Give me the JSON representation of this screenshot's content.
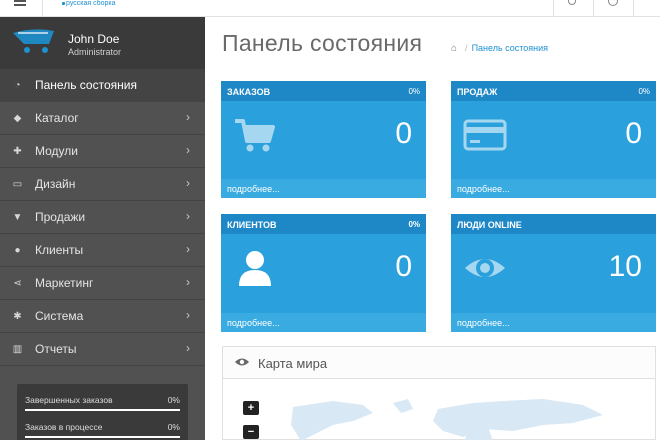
{
  "topbar": {
    "brand_sub": "русская сборка"
  },
  "sidebar": {
    "user_name": "John Doe",
    "user_role": "Administrator",
    "items": [
      {
        "label": "Панель состояния",
        "icon": "dashboard-icon",
        "active": true
      },
      {
        "label": "Каталог",
        "icon": "tag-icon"
      },
      {
        "label": "Модули",
        "icon": "puzzle-icon"
      },
      {
        "label": "Дизайн",
        "icon": "monitor-icon"
      },
      {
        "label": "Продажи",
        "icon": "shopping-cart-icon"
      },
      {
        "label": "Клиенты",
        "icon": "user-icon"
      },
      {
        "label": "Маркетинг",
        "icon": "share-icon"
      },
      {
        "label": "Система",
        "icon": "gear-icon"
      },
      {
        "label": "Отчеты",
        "icon": "bar-chart-icon"
      }
    ],
    "progress": [
      {
        "label": "Завершенных заказов",
        "pct": "0%"
      },
      {
        "label": "Заказов в процессе",
        "pct": "0%"
      }
    ]
  },
  "main": {
    "title": "Панель состояния",
    "breadcrumb": "Панель состояния",
    "tiles": [
      {
        "title": "ЗАКАЗОВ",
        "pct": "0%",
        "value": "0",
        "icon": "shopping-cart-icon",
        "more": "подробнее..."
      },
      {
        "title": "ПРОДАЖ",
        "pct": "0%",
        "value": "0",
        "icon": "credit-card-icon",
        "more": "подробнее..."
      },
      {
        "title": "КЛИЕНТОВ",
        "pct": "0%",
        "value": "0",
        "icon": "user-icon",
        "more": "подробнее..."
      },
      {
        "title": "ЛЮДИ ONLINE",
        "pct": "",
        "value": "10",
        "icon": "eye-icon",
        "more": "подробнее..."
      }
    ],
    "map": {
      "title": "Карта мира",
      "zoom_in": "+",
      "zoom_out": "−"
    }
  },
  "colors": {
    "tile_body": "#2aa0dc",
    "tile_head": "#1e88c7",
    "tile_foot": "#3aabe0",
    "sidebar": "#515151",
    "accent": "#1e91cf"
  }
}
